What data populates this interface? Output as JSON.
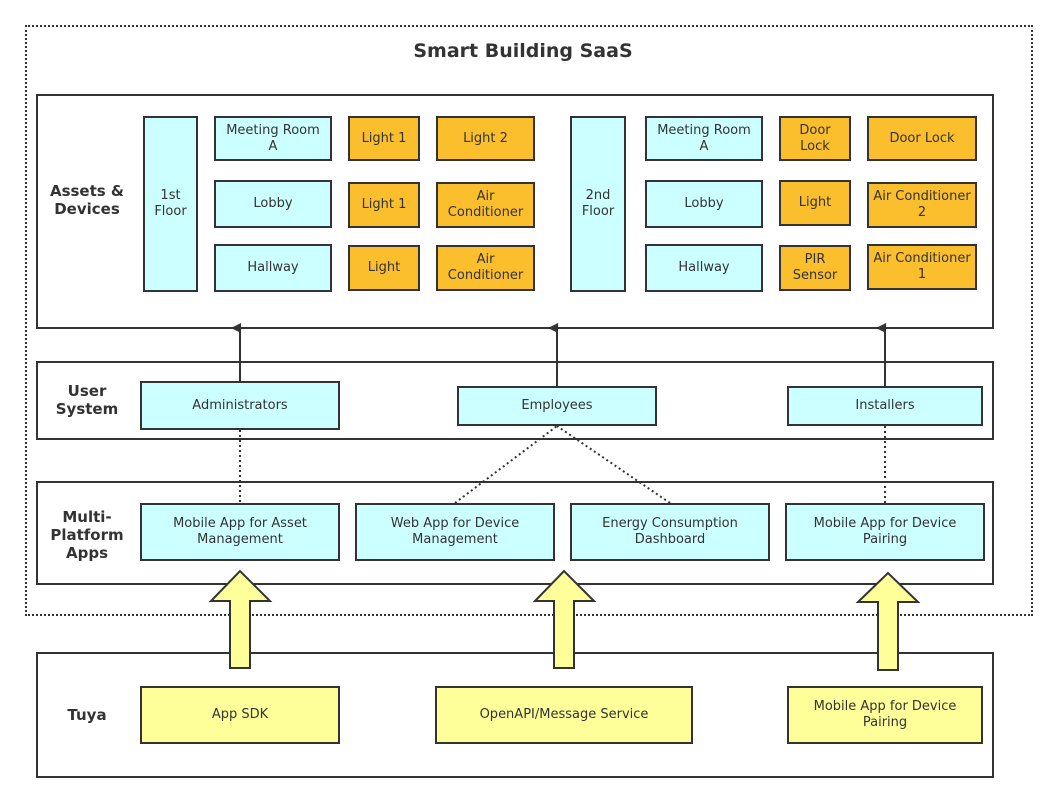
{
  "title": "Smart Building SaaS",
  "colors": {
    "room_fill": "#ccffff",
    "device_fill": "#fbbf2d",
    "tuya_fill": "#ffff99",
    "stroke": "#333333"
  },
  "layers": {
    "assets": {
      "label": "Assets & Devices",
      "floors": [
        {
          "name": "1st Floor",
          "rooms": [
            {
              "name": "Meeting Room A",
              "devices": [
                "Light 1",
                "Light 2"
              ]
            },
            {
              "name": "Lobby",
              "devices": [
                "Light 1",
                "Air Conditioner"
              ]
            },
            {
              "name": "Hallway",
              "devices": [
                "Light",
                "Air Conditioner"
              ]
            }
          ]
        },
        {
          "name": "2nd Floor",
          "rooms": [
            {
              "name": "Meeting Room A",
              "devices": [
                "Door Lock",
                "Door Lock"
              ]
            },
            {
              "name": "Lobby",
              "devices": [
                "Light",
                "Air Conditioner 2"
              ]
            },
            {
              "name": "Hallway",
              "devices": [
                "PIR Sensor",
                "Air Conditioner 1"
              ]
            }
          ]
        }
      ]
    },
    "users": {
      "label": "User System",
      "items": [
        "Administrators",
        "Employees",
        "Installers"
      ]
    },
    "apps": {
      "label": "Multi-Platform Apps",
      "items": [
        "Mobile App for Asset Management",
        "Web App for Device Management",
        "Energy Consumption Dashboard",
        "Mobile App for Device Pairing"
      ]
    },
    "tuya": {
      "label": "Tuya",
      "items": [
        "App SDK",
        "OpenAPI/Message Service",
        "Mobile App for Device Pairing"
      ]
    }
  }
}
